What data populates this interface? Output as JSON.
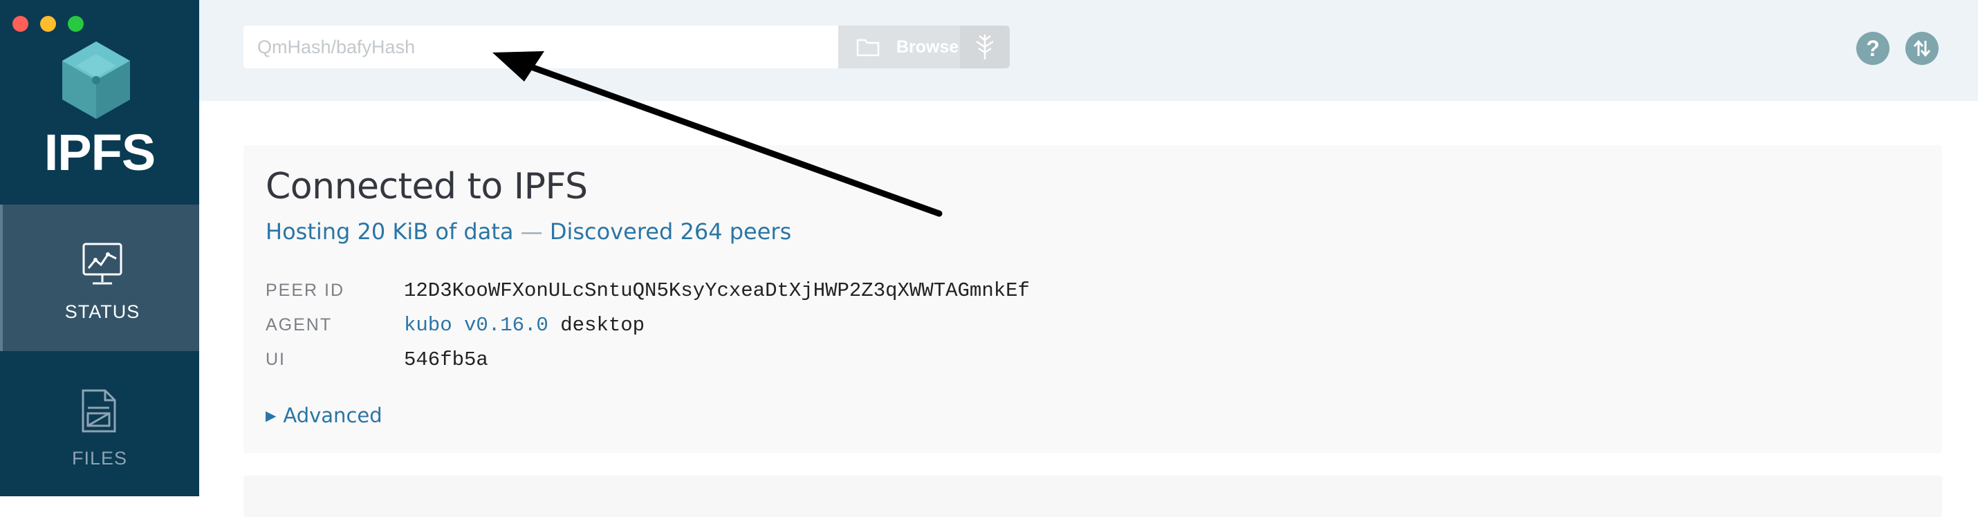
{
  "window": {
    "controls": [
      "close",
      "minimize",
      "zoom"
    ]
  },
  "brand": {
    "name": "IPFS",
    "logo_icon": "ipfs-cube-icon",
    "colors": {
      "sidebar": "#0b3a53",
      "active_nav": "#355468",
      "accent": "#2a75a6"
    }
  },
  "sidebar": {
    "items": [
      {
        "label": "STATUS",
        "icon": "status-monitor-icon",
        "active": true
      },
      {
        "label": "FILES",
        "icon": "files-document-icon",
        "active": false
      }
    ]
  },
  "topbar": {
    "search": {
      "value": "",
      "placeholder": "QmHash/bafyHash"
    },
    "browse_label": "Browse",
    "browse_icon": "folder-icon",
    "tree_icon": "tree-icon",
    "help_icon": "help-icon",
    "sync_icon": "sync-arrows-icon"
  },
  "status": {
    "title": "Connected to IPFS",
    "hosting": "Hosting 20 KiB of data",
    "separator": "—",
    "peers": "Discovered 264 peers",
    "rows": [
      {
        "label": "PEER ID",
        "value": "12D3KooWFXonULcSntuQN5KsyYcxeaDtXjHWP2Z3qXWWTAGmnkEf"
      },
      {
        "label": "AGENT",
        "link": "kubo v0.16.0",
        "suffix": " desktop"
      },
      {
        "label": "UI",
        "value": "546fb5a"
      }
    ],
    "advanced_label": "Advanced"
  }
}
